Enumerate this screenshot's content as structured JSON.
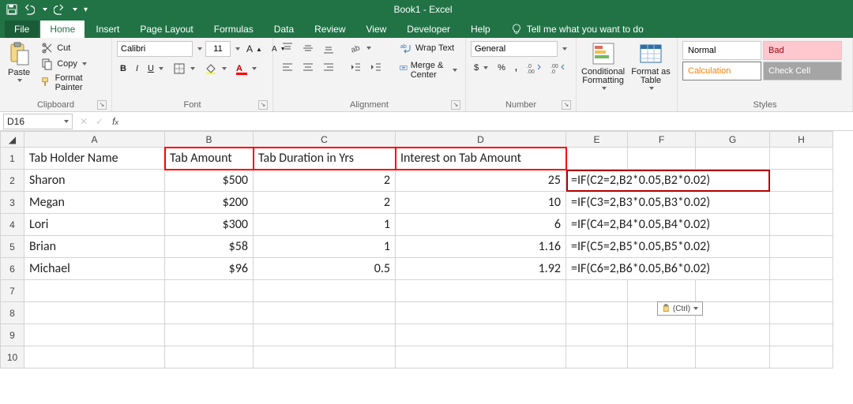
{
  "app": {
    "title": "Book1 - Excel"
  },
  "qat": {
    "save": "save",
    "undo": "undo",
    "redo": "redo"
  },
  "tabs": {
    "file": "File",
    "items": [
      "Home",
      "Insert",
      "Page Layout",
      "Formulas",
      "Data",
      "Review",
      "View",
      "Developer",
      "Help"
    ],
    "active": "Home",
    "tell_me": "Tell me what you want to do"
  },
  "ribbon": {
    "clipboard": {
      "label": "Clipboard",
      "paste": "Paste",
      "cut": "Cut",
      "copy": "Copy",
      "format_painter": "Format Painter"
    },
    "font": {
      "label": "Font",
      "name": "Calibri",
      "size": "11",
      "bold": "B",
      "italic": "I",
      "underline": "U"
    },
    "alignment": {
      "label": "Alignment",
      "wrap": "Wrap Text",
      "merge": "Merge & Center"
    },
    "number": {
      "label": "Number",
      "format": "General",
      "currency": "$",
      "percent": "%",
      "comma": ","
    },
    "cond": {
      "cond_fmt": "Conditional Formatting",
      "fmt_table": "Format as Table"
    },
    "styles": {
      "label": "Styles",
      "normal": "Normal",
      "bad": "Bad",
      "calculation": "Calculation",
      "check": "Check Cell"
    }
  },
  "fbar": {
    "namebox": "D16",
    "formula": ""
  },
  "paste_tag": "(Ctrl)",
  "sheet": {
    "columns": [
      "A",
      "B",
      "C",
      "D",
      "E",
      "F",
      "G",
      "H"
    ],
    "headers": {
      "A": "Tab Holder Name",
      "B": "Tab Amount",
      "C": "Tab Duration in Yrs",
      "D": "Interest on Tab Amount"
    },
    "rows": [
      {
        "n": "2",
        "A": "Sharon",
        "B": "$500",
        "C": "2",
        "D": "25",
        "E": "=IF(C2=2,B2*0.05,B2*0.02)"
      },
      {
        "n": "3",
        "A": "Megan",
        "B": "$200",
        "C": "2",
        "D": "10",
        "E": "=IF(C3=2,B3*0.05,B3*0.02)"
      },
      {
        "n": "4",
        "A": "Lori",
        "B": "$300",
        "C": "1",
        "D": "6",
        "E": "=IF(C4=2,B4*0.05,B4*0.02)"
      },
      {
        "n": "5",
        "A": "Brian",
        "B": "$58",
        "C": "1",
        "D": "1.16",
        "E": "=IF(C5=2,B5*0.05,B5*0.02)"
      },
      {
        "n": "6",
        "A": "Michael",
        "B": "$96",
        "C": "0.5",
        "D": "1.92",
        "E": "=IF(C6=2,B6*0.05,B6*0.02)"
      }
    ],
    "blank_rows": [
      "7",
      "8",
      "9",
      "10"
    ]
  }
}
